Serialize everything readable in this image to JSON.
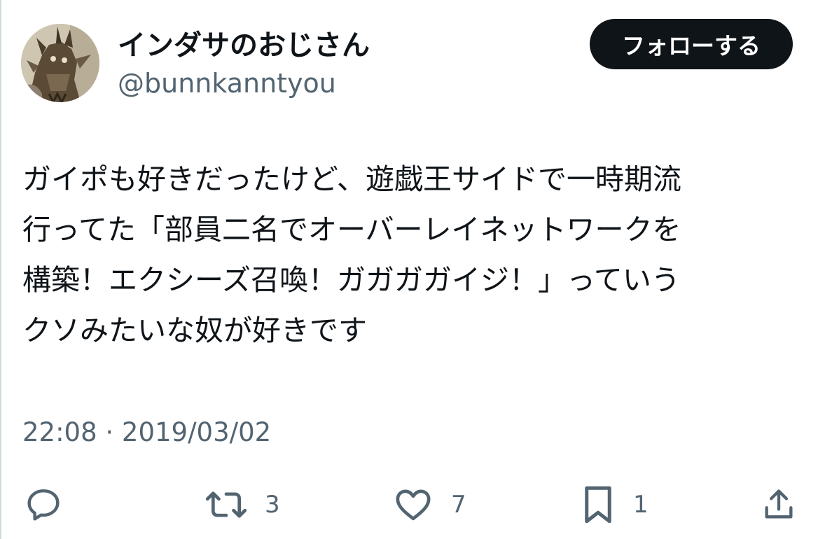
{
  "user": {
    "display_name": "インダサのおじさん",
    "handle": "@bunnkanntyou",
    "follow_label": "フォローする"
  },
  "tweet": {
    "lines": [
      "ガイポも好きだったけど、遊戯王サイドで一時期流",
      "行ってた「部員二名でオーバーレイネットワークを",
      "構築！エクシーズ召喚！ガガガガイジ！」っていう",
      "クソみたいな奴が好きです"
    ],
    "timestamp": "22:08 · 2019/03/02"
  },
  "actions": {
    "reply": {
      "icon": "reply-icon",
      "count": ""
    },
    "retweet": {
      "icon": "retweet-icon",
      "count": "3"
    },
    "like": {
      "icon": "heart-icon",
      "count": "7"
    },
    "bookmark": {
      "icon": "bookmark-icon",
      "count": "1"
    },
    "share": {
      "icon": "share-icon",
      "count": ""
    }
  },
  "colors": {
    "text": "#0f1419",
    "secondary": "#536471",
    "button_bg": "#0f1419",
    "button_text": "#ffffff",
    "border": "#cfd9de"
  }
}
